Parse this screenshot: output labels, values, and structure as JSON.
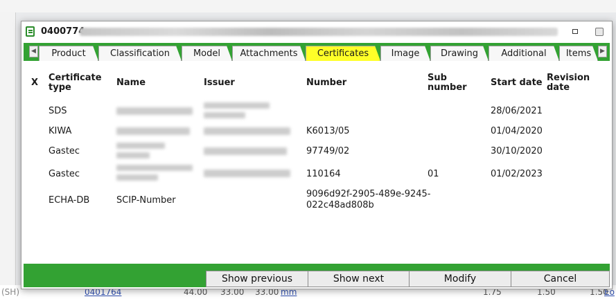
{
  "background": {
    "row_id": "0401764",
    "values": [
      "44.00",
      "33.00",
      "33.00"
    ],
    "link": "mm",
    "values2": [
      "1.75",
      "1.50",
      "1.50"
    ],
    "edge_link": "Eo",
    "side_text": "(SH)"
  },
  "dialog": {
    "title": "0400774",
    "tabs": [
      "Product",
      "Classification",
      "Model",
      "Attachments",
      "Certificates",
      "Image",
      "Drawing",
      "Additional",
      "Items"
    ],
    "active_tab": "Certificates",
    "columns": {
      "x": "X",
      "certificate_type": "Certificate type",
      "name": "Name",
      "issuer": "Issuer",
      "number": "Number",
      "sub_number": "Sub number",
      "start_date": "Start date",
      "revision_date": "Revision date"
    },
    "rows": [
      {
        "type": "SDS",
        "name": "",
        "issuer": "",
        "number": "",
        "sub_number": "",
        "start_date": "28/06/2021",
        "revision_date": ""
      },
      {
        "type": "KIWA",
        "name": "",
        "issuer": "",
        "number": "K6013/05",
        "sub_number": "",
        "start_date": "01/04/2020",
        "revision_date": ""
      },
      {
        "type": "Gastec",
        "name": "",
        "issuer": "",
        "number": "97749/02",
        "sub_number": "",
        "start_date": "30/10/2020",
        "revision_date": ""
      },
      {
        "type": "Gastec",
        "name": "",
        "issuer": "",
        "number": "110164",
        "sub_number": "01",
        "start_date": "01/02/2023",
        "revision_date": ""
      },
      {
        "type": "ECHA-DB",
        "name": "SCIP-Number",
        "issuer": "",
        "number": "9096d92f-2905-489e-9245-022c48ad808b",
        "sub_number": "",
        "start_date": "",
        "revision_date": ""
      }
    ],
    "buttons": {
      "show_previous": "Show previous",
      "show_next": "Show next",
      "modify": "Modify",
      "cancel": "Cancel"
    }
  },
  "colors": {
    "accent_green": "#33a233",
    "active_tab": "#ffff28"
  }
}
